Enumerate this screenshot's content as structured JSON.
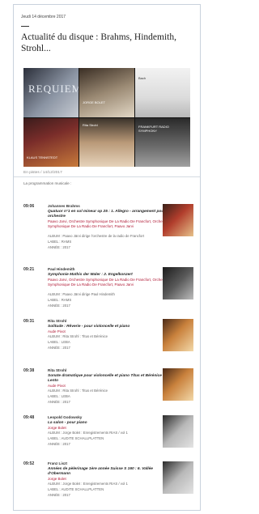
{
  "page": {
    "date": "Jeudi 14 décembre 2017",
    "title": "Actualité du disque : Brahms, Hindemith, Strohl...",
    "caption": "En pistes / 14/12/2017",
    "program_heading": "La programmation musicale :"
  },
  "collage": {
    "covers": [
      {
        "text": "REQUIEM"
      },
      {
        "text": "JORGE BOLET"
      },
      {
        "text": "Bach"
      },
      {
        "text": "KLAUS TENNSTEDT"
      },
      {
        "text": "Rita Strohl"
      },
      {
        "text": "FRANKFURT RADIO SYMPHONY"
      }
    ]
  },
  "items": [
    {
      "time": "09:06",
      "composer": "Johannes Brahms",
      "work": "Quatuor n°1 en sol mineur op 25 : 1. Allegro - arrangement pour orchestre",
      "performers": "Paavo Jarvi, Orchestre Symphonique De La Radio De Francfort, Orchestre Symphonique De La Radio De Francfort, Paavo Jarvi",
      "album": "ALBUM : Paavo Järvi dirige l'orchestre de la radio de Francfort",
      "label": "LABEL : RAMS",
      "year": "ANNÉE : 2017"
    },
    {
      "time": "09:21",
      "composer": "Paul Hindemith",
      "work": "Symphonie Mathis der Maler : 2. Engelkonzert",
      "performers": "Paavo Jarvi, Orchestre Symphonique De La Radio De Francfort, Orchestre Symphonique De La Radio De Francfort, Paavo Jarvi",
      "album": "ALBUM : Paavo Järvi dirige Paul Hindemith",
      "label": "LABEL : RAMS",
      "year": "ANNÉE : 2017"
    },
    {
      "time": "09:31",
      "composer": "Rita Strohl",
      "work": "Solitude : Rêverie - pour violoncelle et piano",
      "performers": "Aude Pivot",
      "album": "ALBUM : Rita Strohl : Titus et Bérénice",
      "label": "LABEL : LEBA",
      "year": "ANNÉE : 2017"
    },
    {
      "time": "09:38",
      "composer": "Rita Strohl",
      "work": "Sonate dramatique pour violoncelle et piano Titus et Bérénice : 3. Lento",
      "performers": "Aude Pivot",
      "album": "ALBUM : Rita Strohl : Titus et Bérénice",
      "label": "LABEL : LEBA",
      "year": "ANNÉE : 2017"
    },
    {
      "time": "09:48",
      "composer": "Leopold Godowsky",
      "work": "La salon - pour piano",
      "performers": "Jorge Bolet",
      "album": "ALBUM : Jorge Bolet : Enregistrements RIAS / vol 1",
      "label": "LABEL : AUDITE SCHALLPLATTEN",
      "year": "ANNÉE : 2017"
    },
    {
      "time": "09:52",
      "composer": "Franz Liszt",
      "work": "Années de pèlerinage 1ère année Suisse S 160 : 6. Vallée d'Obermann",
      "performers": "Jorge Bolet",
      "album": "ALBUM : Jorge Bolet : Enregistrements RIAS / vol 1",
      "label": "LABEL : AUDITE SCHALLPLATTEN",
      "year": "ANNÉE : 2017"
    }
  ]
}
